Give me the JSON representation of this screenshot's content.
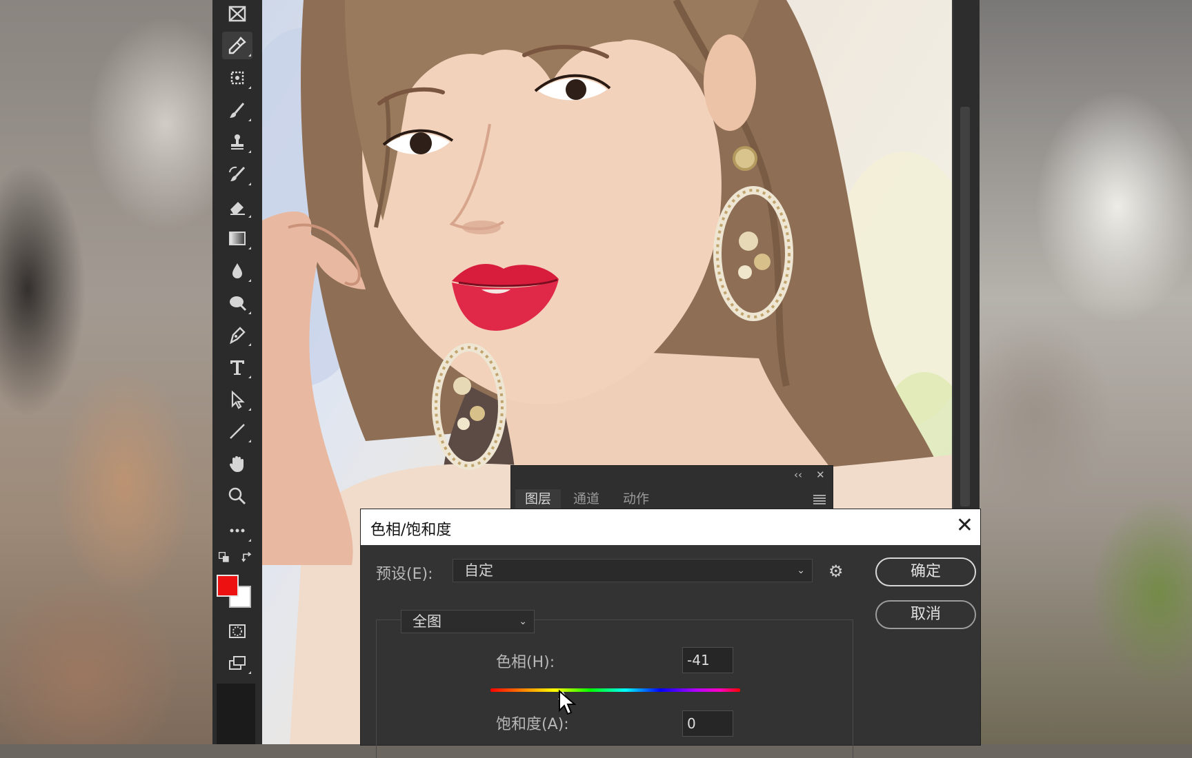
{
  "dialog": {
    "title": "色相/饱和度",
    "close_glyph": "✕",
    "preset_label": "预设(E):",
    "preset_value": "自定",
    "ok_label": "确定",
    "cancel_label": "取消",
    "range_value": "全图",
    "hue_label": "色相(H):",
    "hue_value": "-41",
    "saturation_label": "饱和度(A):",
    "saturation_value": "0"
  },
  "layers_panel": {
    "collapse_glyph": "‹‹",
    "close_glyph": "✕",
    "tabs": [
      "图层",
      "通道",
      "动作"
    ]
  },
  "toolbar": {
    "tools": [
      "frame-tool-icon",
      "eyedropper-tool-icon",
      "crop-tool-icon",
      "brush-tool-icon",
      "clone-stamp-tool-icon",
      "history-brush-tool-icon",
      "eraser-tool-icon",
      "gradient-tool-icon",
      "blur-tool-icon",
      "dodge-tool-icon",
      "pen-tool-icon",
      "type-tool-icon",
      "path-selection-tool-icon",
      "line-tool-icon",
      "hand-tool-icon",
      "zoom-tool-icon",
      "more-tools-icon"
    ],
    "foreground_color": "#ee1111",
    "background_color": "#ffffff"
  },
  "colors": {
    "dialog_bg": "#333333",
    "toolbar_bg": "#2b2b2b",
    "lip_color": "#d81d3c"
  }
}
